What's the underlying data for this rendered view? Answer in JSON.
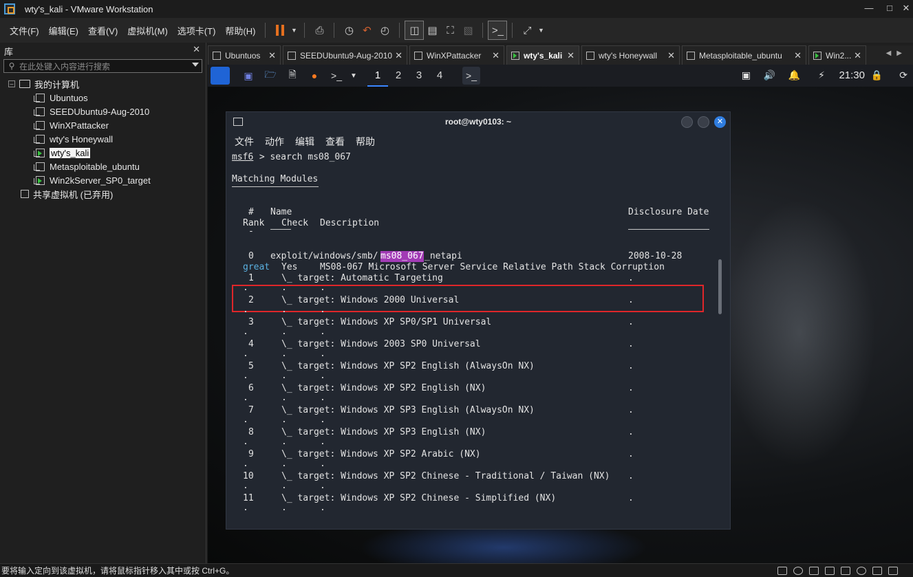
{
  "window": {
    "title": "wty's_kali - VMware Workstation"
  },
  "menubar": {
    "items": [
      "文件(F)",
      "编辑(E)",
      "查看(V)",
      "虚拟机(M)",
      "选项卡(T)",
      "帮助(H)"
    ]
  },
  "library": {
    "title": "库",
    "search_placeholder": "在此处键入内容进行搜索",
    "root_label": "我的计算机",
    "vms": [
      "Ubuntuos",
      "SEEDUbuntu9-Aug-2010",
      "WinXPattacker",
      "wty's Honeywall",
      "wty's_kali",
      "Metasploitable_ubuntu",
      "Win2kServer_SP0_target"
    ],
    "selected_vm": "wty's_kali",
    "shared_label": "共享虚拟机 (已弃用)"
  },
  "tabs": [
    "Ubuntuos",
    "SEEDUbuntu9-Aug-2010",
    "WinXPattacker",
    "wty's_kali",
    "wty's Honeywall",
    "Metasploitable_ubuntu",
    "Win2..."
  ],
  "active_tab": "wty's_kali",
  "kali_panel": {
    "workspaces": [
      "1",
      "2",
      "3",
      "4"
    ],
    "active_workspace": "1",
    "clock": "21:30"
  },
  "terminal": {
    "title": "root@wty0103: ~",
    "menu": [
      "文件",
      "动作",
      "编辑",
      "查看",
      "帮助"
    ],
    "prompt": "msf6",
    "command": " > search ms08_067",
    "section_title": "Matching Modules",
    "header_hash": "#",
    "header_name": "Name",
    "header_date": "Disclosure Date",
    "header_rank": "Rank",
    "header_check": "Check",
    "header_desc": "Description",
    "header_dash": "-",
    "module": {
      "index": "0",
      "path_prefix": "exploit/windows/smb/",
      "path_match": "ms08_067",
      "path_suffix": "_netapi",
      "date": "2008-10-28",
      "rank": "great",
      "check": "Yes",
      "description": "MS08-067 Microsoft Server Service Relative Path Stack Corruption"
    },
    "dot": ".",
    "targets": [
      {
        "index": "1",
        "text": "\\_ target: Automatic Targeting"
      },
      {
        "index": "2",
        "text": "\\_ target: Windows 2000 Universal"
      },
      {
        "index": "3",
        "text": "\\_ target: Windows XP SP0/SP1 Universal"
      },
      {
        "index": "4",
        "text": "\\_ target: Windows 2003 SP0 Universal"
      },
      {
        "index": "5",
        "text": "\\_ target: Windows XP SP2 English (AlwaysOn NX)"
      },
      {
        "index": "6",
        "text": "\\_ target: Windows XP SP2 English (NX)"
      },
      {
        "index": "7",
        "text": "\\_ target: Windows XP SP3 English (AlwaysOn NX)"
      },
      {
        "index": "8",
        "text": "\\_ target: Windows XP SP3 English (NX)"
      },
      {
        "index": "9",
        "text": "\\_ target: Windows XP SP2 Arabic (NX)"
      },
      {
        "index": "10",
        "text": "\\_ target: Windows XP SP2 Chinese - Traditional / Taiwan (NX)"
      },
      {
        "index": "11",
        "text": "\\_ target: Windows XP SP2 Chinese - Simplified (NX)"
      }
    ]
  },
  "statusbar": {
    "text": "要将输入定向到该虚拟机，请将鼠标指针移入其中或按 Ctrl+G。"
  }
}
